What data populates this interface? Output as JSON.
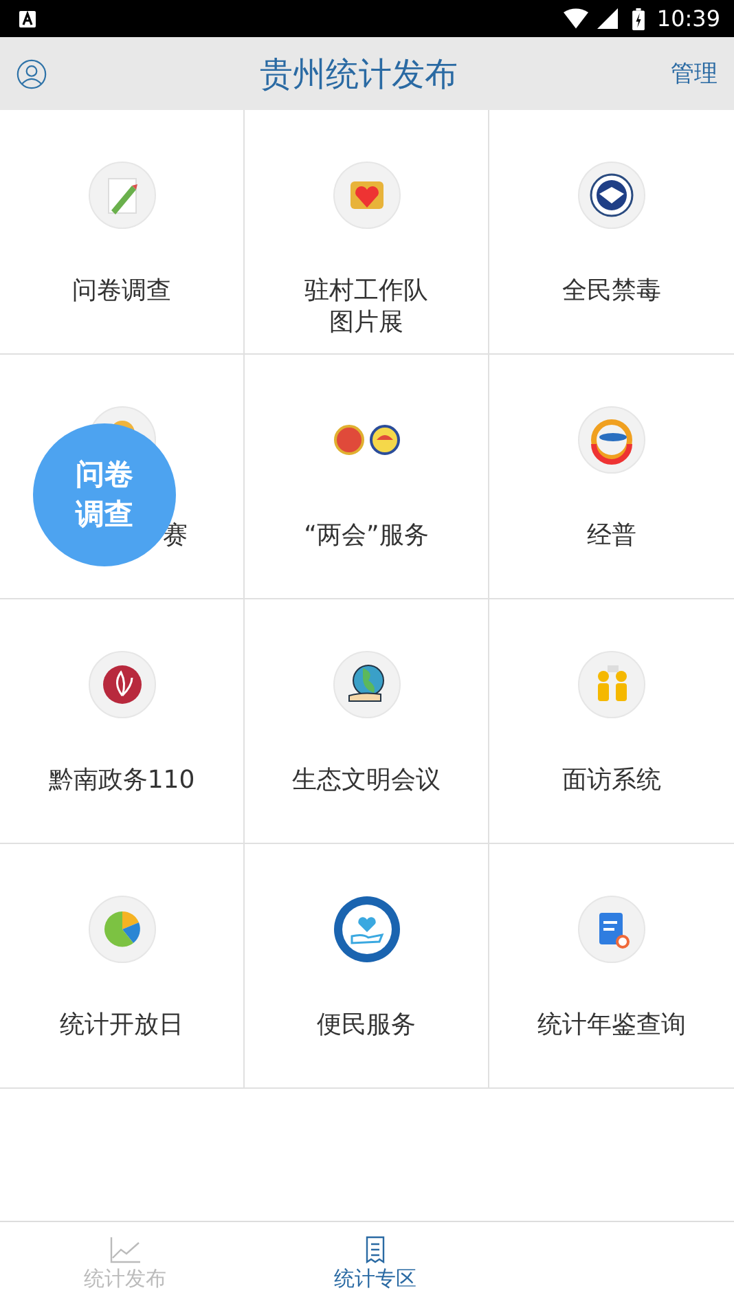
{
  "status_bar": {
    "time": "10:39"
  },
  "header": {
    "title": "贵州统计发布",
    "action": "管理"
  },
  "tiles": [
    {
      "label": "问卷调查"
    },
    {
      "label": "驻村工作队图片展"
    },
    {
      "label": "全民禁毒"
    },
    {
      "label": "赛"
    },
    {
      "label": "“两会”服务"
    },
    {
      "label": "经普"
    },
    {
      "label": "黔南政务110"
    },
    {
      "label": "生态文明会议"
    },
    {
      "label": "面访系统"
    },
    {
      "label": "统计开放日"
    },
    {
      "label": "便民服务"
    },
    {
      "label": "统计年鉴查询"
    }
  ],
  "floating_button": {
    "label": "问卷调查"
  },
  "bottom_nav": [
    {
      "label": "统计发布",
      "selected": false
    },
    {
      "label": "统计专区",
      "selected": true
    }
  ]
}
